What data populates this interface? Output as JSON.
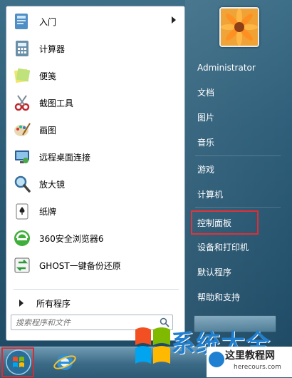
{
  "programs": [
    {
      "label": "入门",
      "icon": "getting-started-icon",
      "has_arrow": true
    },
    {
      "label": "计算器",
      "icon": "calculator-icon"
    },
    {
      "label": "便笺",
      "icon": "sticky-notes-icon"
    },
    {
      "label": "截图工具",
      "icon": "snipping-tool-icon"
    },
    {
      "label": "画图",
      "icon": "paint-icon"
    },
    {
      "label": "远程桌面连接",
      "icon": "remote-desktop-icon"
    },
    {
      "label": "放大镜",
      "icon": "magnifier-icon"
    },
    {
      "label": "纸牌",
      "icon": "solitaire-icon"
    },
    {
      "label": "360安全浏览器6",
      "icon": "360-browser-icon"
    },
    {
      "label": "GHOST一键备份还原",
      "icon": "ghost-backup-icon"
    }
  ],
  "all_programs_label": "所有程序",
  "search": {
    "placeholder": "搜索程序和文件"
  },
  "right_menu": [
    {
      "label": "Administrator"
    },
    {
      "label": "文档"
    },
    {
      "label": "图片"
    },
    {
      "label": "音乐"
    },
    {
      "label": "游戏"
    },
    {
      "label": "计算机"
    },
    {
      "label": "控制面板",
      "highlighted": true
    },
    {
      "label": "设备和打印机"
    },
    {
      "label": "默认程序"
    },
    {
      "label": "帮助和支持"
    }
  ],
  "watermarks": {
    "brand_text": "系统大全",
    "site_title": "这里教程网",
    "site_url": "herecours.com"
  },
  "colors": {
    "highlight": "#e0292f",
    "menu_bg": "#2f5f7a",
    "watermark_blue": "#1f7fd0"
  }
}
